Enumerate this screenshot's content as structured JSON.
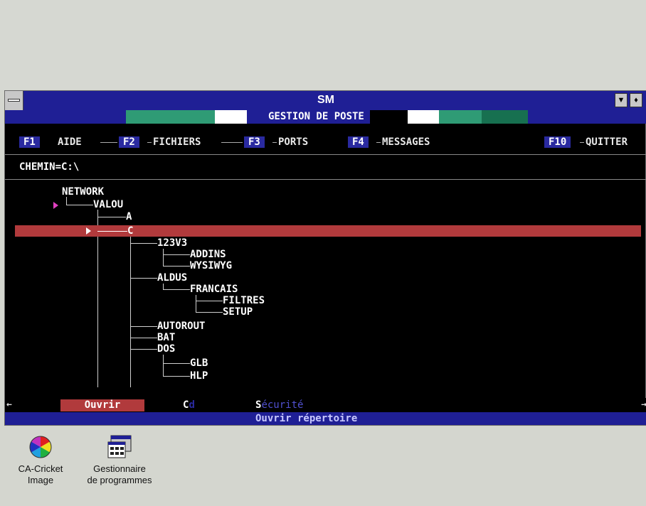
{
  "window": {
    "title": "SM",
    "subtitle": "GESTION DE POSTE",
    "menu_btn_down": "▼",
    "menu_btn_updown": "♦"
  },
  "menu": [
    {
      "key": "F1",
      "label": "AIDE"
    },
    {
      "key": "F2",
      "label": "FICHIERS"
    },
    {
      "key": "F3",
      "label": "PORTS"
    },
    {
      "key": "F4",
      "label": "MESSAGES"
    },
    {
      "key": "F10",
      "label": "QUITTER"
    }
  ],
  "path": "CHEMIN=C:\\",
  "tree": {
    "network": "NETWORK",
    "valou": "VALOU",
    "a": "A",
    "c": "C",
    "n123v3": "123V3",
    "addins": "ADDINS",
    "wysiwyg": "WYSIWYG",
    "aldus": "ALDUS",
    "francais": "FRANCAIS",
    "filtres": "FILTRES",
    "setup": "SETUP",
    "autorout": "AUTOROUT",
    "bat": "BAT",
    "dos": "DOS",
    "glb": "GLB",
    "hlp": "HLP"
  },
  "commands": {
    "open": "Ouvrir",
    "cd_c": "C",
    "cd_d": "d",
    "security_s": "S",
    "security_rest": "écurité",
    "status": "Ouvrir répertoire"
  },
  "desktop_icons": [
    {
      "line1": "CA-Cricket",
      "line2": "Image"
    },
    {
      "line1": "Gestionnaire",
      "line2": "de programmes"
    }
  ],
  "colors": {
    "titlebar": "#1f1f95",
    "selection": "#b13a3c",
    "band_green": "#2f9b75",
    "band_dark_green": "#177050"
  }
}
